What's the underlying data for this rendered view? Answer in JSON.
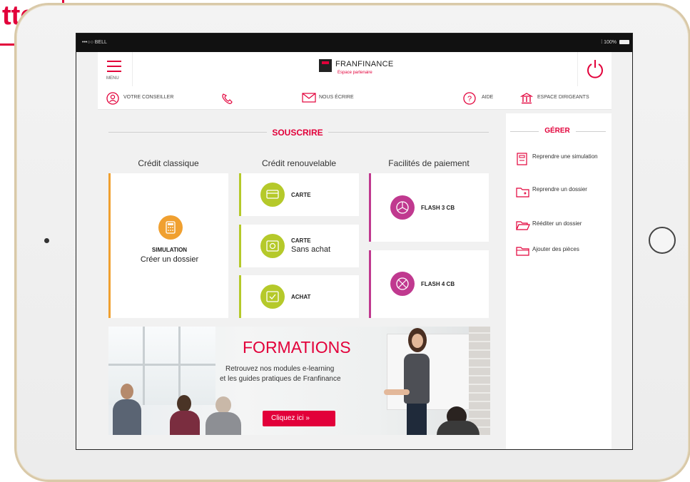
{
  "badge": {
    "text": "tte"
  },
  "status": {
    "carrier": "•••○○ BELL",
    "battery": "⁞ 100%"
  },
  "header": {
    "menu_label": "MENU",
    "brand": "FRANFINANCE",
    "brand_sub": "Espace partenaire"
  },
  "infobar": {
    "conseiller": "VOTRE CONSEILLER",
    "ecrire": "NOUS ÉCRIRE",
    "aide": "AIDE",
    "dirigeants": "ESPACE DIRIGEANTS"
  },
  "souscrire": {
    "title": "SOUSCRIRE",
    "columns": [
      {
        "heading": "Crédit classique"
      },
      {
        "heading": "Crédit renouvelable"
      },
      {
        "heading": "Facilités de paiement"
      }
    ],
    "simulation": {
      "label": "SIMULATION",
      "sub": "Créer un dossier"
    },
    "carte": {
      "label": "CARTE"
    },
    "carte_sans_achat": {
      "label": "CARTE",
      "sub": "Sans achat"
    },
    "achat": {
      "label": "ACHAT"
    },
    "flash3": {
      "label": "FLASH 3 CB"
    },
    "flash4": {
      "label": "FLASH 4 CB"
    }
  },
  "gerer": {
    "title": "GÉRER",
    "items": [
      {
        "label": "Reprendre une simulation"
      },
      {
        "label": "Reprendre un dossier"
      },
      {
        "label": "Rééditer un dossier"
      },
      {
        "label": "Ajouter des pièces"
      }
    ]
  },
  "banner": {
    "title": "FORMATIONS",
    "line1": "Retrouvez nos modules e-learning",
    "line2": "et les guides pratiques de Franfinance",
    "cta": "Cliquez ici  »"
  },
  "colors": {
    "accent": "#e2003a",
    "orange": "#f0a030",
    "lime": "#b5c92a",
    "magenta": "#c0398f"
  }
}
